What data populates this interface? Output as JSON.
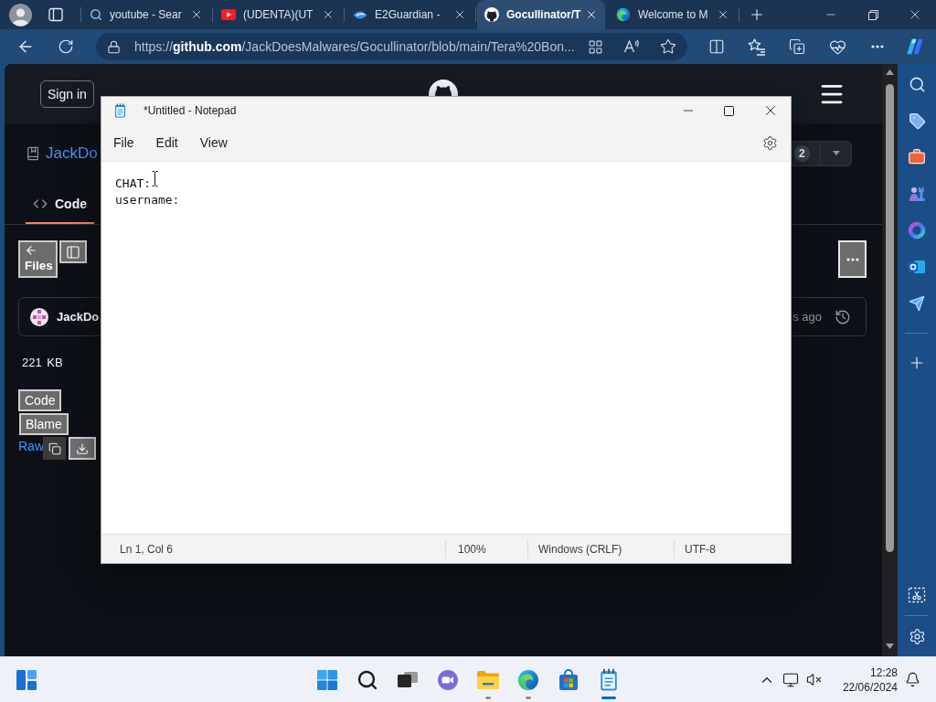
{
  "browser": {
    "tabs": [
      {
        "title": "youtube - Sear",
        "selected": false
      },
      {
        "title": "(UDENTA)(UT",
        "selected": false
      },
      {
        "title": "E2Guardian -",
        "selected": false
      },
      {
        "title": "Gocullinator/T",
        "selected": true
      },
      {
        "title": "Welcome to M",
        "selected": false
      }
    ],
    "address_bar": {
      "url": "https://**github.com**/JackDoesMalwares/Gocullinator/blob/main/Tera%20Bon..."
    }
  },
  "github": {
    "header": {
      "sign_in": "Sign in"
    },
    "repo": {
      "name": "JackDo",
      "counter": "2"
    },
    "nav_tabs": [
      {
        "label": "Code",
        "selected": true
      }
    ],
    "files_button": "Files",
    "commit": {
      "author": "JackDo",
      "time": "s ago"
    },
    "file_size": "221 KB",
    "view_buttons": [
      "Code",
      "Blame"
    ],
    "raw_link": "Raw"
  },
  "notepad": {
    "title": "*Untitled - Notepad",
    "menu": [
      "File",
      "Edit",
      "View"
    ],
    "lines": [
      "CHAT:",
      "username:"
    ],
    "status_bar": {
      "position": "Ln 1, Col 6",
      "zoom": "100%",
      "line_endings": "Windows (CRLF)",
      "encoding": "UTF-8"
    }
  },
  "taskbar": {
    "apps": [
      {
        "running": false,
        "active": false
      },
      {
        "running": true,
        "active": false
      },
      {
        "running": true,
        "active": false
      },
      {
        "running": false,
        "active": false
      },
      {
        "running": true,
        "active": true
      }
    ],
    "clock": {
      "time": "12:28",
      "date": "22/06/2024"
    }
  }
}
